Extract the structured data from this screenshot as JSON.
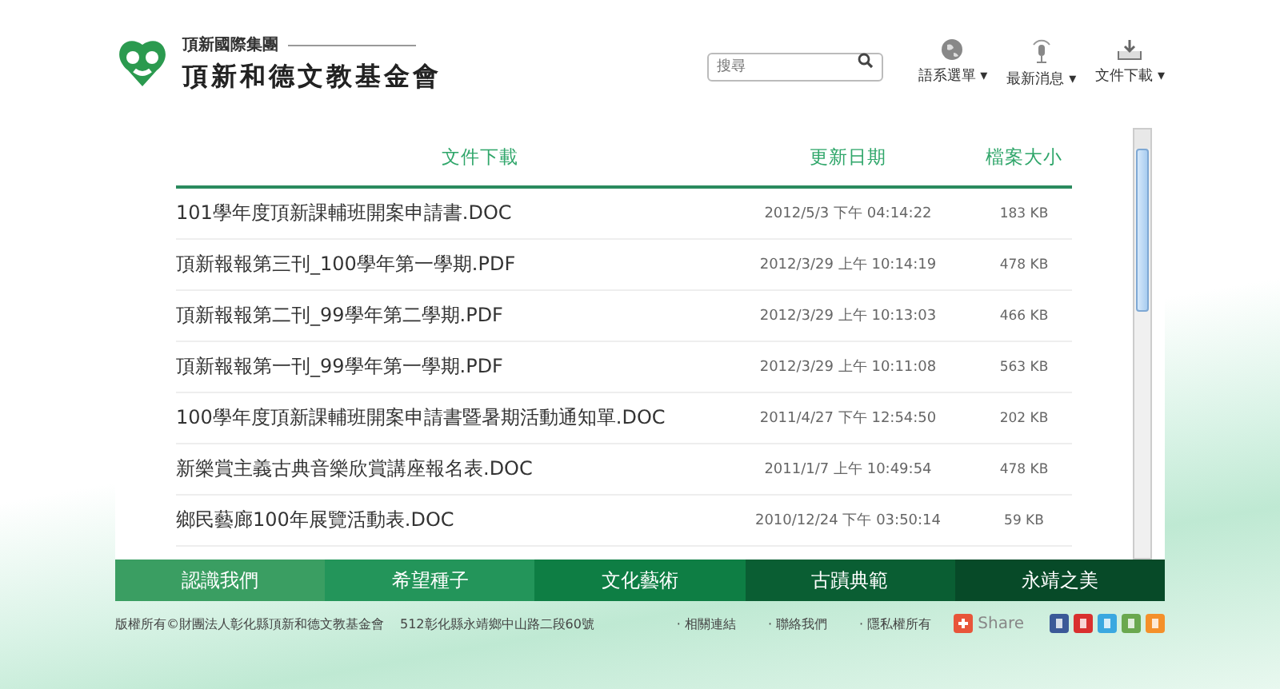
{
  "header": {
    "group_name": "頂新國際集團",
    "org_name": "頂新和德文教基金會",
    "search": {
      "placeholder": "搜尋"
    },
    "menus": [
      {
        "label": "語系選單",
        "caret": "▾"
      },
      {
        "label": "最新消息",
        "caret": "▾"
      },
      {
        "label": "文件下載",
        "caret": "▾"
      }
    ]
  },
  "table": {
    "columns": [
      "文件下載",
      "更新日期",
      "檔案大小"
    ],
    "rows": [
      {
        "name": "101學年度頂新課輔班開案申請書.DOC",
        "date": "2012/5/3 下午 04:14:22",
        "size": "183 KB"
      },
      {
        "name": "頂新報報第三刊_100學年第一學期.PDF",
        "date": "2012/3/29 上午 10:14:19",
        "size": "478 KB"
      },
      {
        "name": "頂新報報第二刊_99學年第二學期.PDF",
        "date": "2012/3/29 上午 10:13:03",
        "size": "466 KB"
      },
      {
        "name": "頂新報報第一刊_99學年第一學期.PDF",
        "date": "2012/3/29 上午 10:11:08",
        "size": "563 KB"
      },
      {
        "name": "100學年度頂新課輔班開案申請書暨暑期活動通知單.DOC",
        "date": "2011/4/27 下午 12:54:50",
        "size": "202 KB"
      },
      {
        "name": "新樂賞主義古典音樂欣賞講座報名表.DOC",
        "date": "2011/1/7 上午 10:49:54",
        "size": "478 KB"
      },
      {
        "name": "鄉民藝廊100年展覽活動表.DOC",
        "date": "2010/12/24 下午 03:50:14",
        "size": "59 KB"
      }
    ]
  },
  "nav": [
    {
      "label": "認識我們",
      "color": "#3a9e62"
    },
    {
      "label": "希望種子",
      "color": "#23955a"
    },
    {
      "label": "文化藝術",
      "color": "#0e7e44"
    },
    {
      "label": "古蹟典範",
      "color": "#0a5e33"
    },
    {
      "label": "永靖之美",
      "color": "#074a28"
    }
  ],
  "footer": {
    "copyright": "版權所有©財團法人彰化縣頂新和德文教基金會",
    "address": "512彰化縣永靖鄉中山路二段60號",
    "links": [
      "· 相關連結",
      "· 聯絡我們",
      "· 隱私權所有"
    ],
    "share": "Share"
  }
}
